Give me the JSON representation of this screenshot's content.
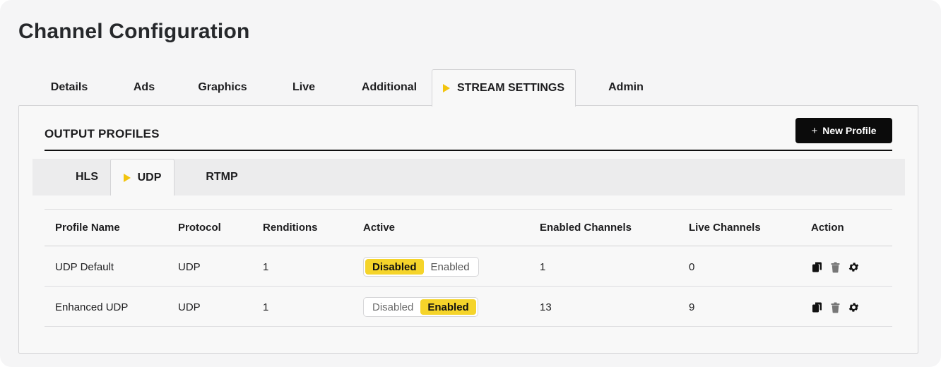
{
  "page": {
    "title": "Channel Configuration"
  },
  "main_tabs": [
    {
      "label": "Details",
      "active": false
    },
    {
      "label": "Ads",
      "active": false
    },
    {
      "label": "Graphics",
      "active": false
    },
    {
      "label": "Live",
      "active": false
    },
    {
      "label": "Additional",
      "active": false
    },
    {
      "label": "STREAM SETTINGS",
      "active": true,
      "marker": "play-triangle-icon"
    },
    {
      "label": "Admin",
      "active": false
    }
  ],
  "panel": {
    "section_title": "OUTPUT PROFILES",
    "new_profile_button": {
      "icon": "+",
      "label": "New Profile"
    }
  },
  "sub_tabs": [
    {
      "label": "HLS",
      "active": false
    },
    {
      "label": "UDP",
      "active": true,
      "marker": "play-triangle-icon"
    },
    {
      "label": "RTMP",
      "active": false
    }
  ],
  "table": {
    "headers": [
      "Profile Name",
      "Protocol",
      "Renditions",
      "Active",
      "Enabled Channels",
      "Live Channels",
      "Action"
    ],
    "rows": [
      {
        "profile_name": "UDP Default",
        "protocol": "UDP",
        "renditions": "1",
        "active": {
          "disabled_label": "Disabled",
          "enabled_label": "Enabled",
          "value": "Disabled"
        },
        "enabled_channels": "1",
        "live_channels": "0",
        "actions": [
          "copy-icon",
          "trash-icon",
          "gear-icon"
        ]
      },
      {
        "profile_name": "Enhanced UDP",
        "protocol": "UDP",
        "renditions": "1",
        "active": {
          "disabled_label": "Disabled",
          "enabled_label": "Enabled",
          "value": "Enabled"
        },
        "enabled_channels": "13",
        "live_channels": "9",
        "actions": [
          "copy-icon",
          "trash-icon",
          "gear-icon"
        ]
      }
    ]
  },
  "colors": {
    "accent_yellow": "#f5d42a",
    "marker_yellow": "#f2c40e",
    "button_black": "#0b0b0b"
  }
}
